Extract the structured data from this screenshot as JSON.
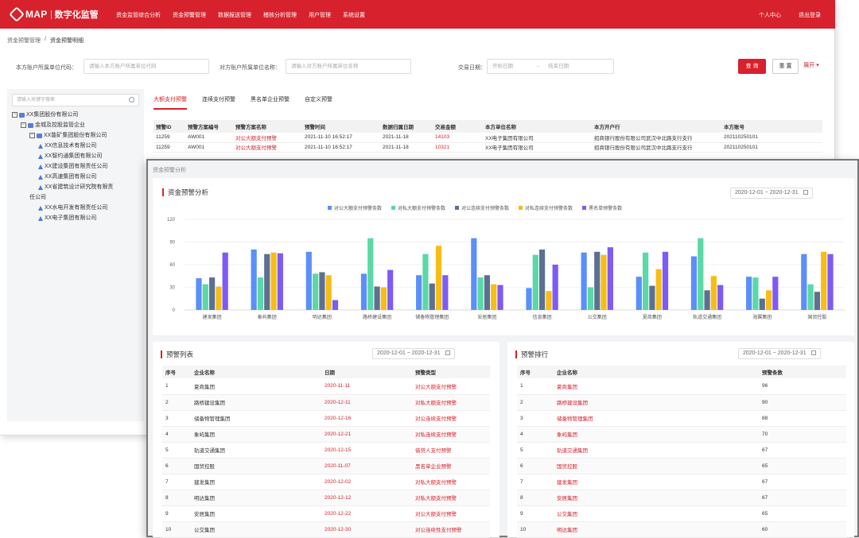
{
  "header": {
    "logo": "MAP",
    "product": "数字化监管",
    "nav": [
      "资金监管综合分析",
      "资金预警管理",
      "数据报送管理",
      "稽核分析管理",
      "用户管理",
      "系统设置"
    ],
    "right": [
      "个人中心",
      "退出登录"
    ]
  },
  "breadcrumb": [
    "资金预警管理",
    "资金预警明细"
  ],
  "filters": {
    "own_label": "本方账户所属单位代码：",
    "own_placeholder": "请输入本方账户所属单位代码",
    "counter_label": "对方账户所属单位名称：",
    "counter_placeholder": "请输入对方账户所属单位名称",
    "date_label": "交易日期：",
    "date_start": "开始日期",
    "date_sep": "→",
    "date_end": "结束日期",
    "query": "查 询",
    "reset": "重 置",
    "expand": "展开 ▾"
  },
  "tree": {
    "search_placeholder": "请输入关键字搜索",
    "nodes": [
      {
        "label": "XX集团股份有限公司",
        "level": 0,
        "kind": "folder",
        "toggle": "−"
      },
      {
        "label": "金城及控股监管企业",
        "level": 1,
        "kind": "folder",
        "toggle": "−"
      },
      {
        "label": "XX能矿集团股份有限公司",
        "level": 2,
        "kind": "folder",
        "toggle": "−"
      },
      {
        "label": "XX信息技术有限公司",
        "level": 3,
        "kind": "home"
      },
      {
        "label": "XX智约通集团有限公司",
        "level": 3,
        "kind": "home"
      },
      {
        "label": "XX建设集团有限责任公司",
        "level": 3,
        "kind": "home"
      },
      {
        "label": "XX高速集团有限公司",
        "level": 3,
        "kind": "home"
      },
      {
        "label": "XX省建筑设计研究院有限责",
        "level": 3,
        "kind": "home"
      },
      {
        "label": "任公司",
        "level": 2,
        "kind": "text"
      },
      {
        "label": "XX水电开发有限责任公司",
        "level": 3,
        "kind": "home"
      },
      {
        "label": "XX电子集团有限公司",
        "level": 3,
        "kind": "home"
      }
    ]
  },
  "tabs": [
    "大额支付预警",
    "连续支付预警",
    "黑名单企业预警",
    "自定义预警"
  ],
  "detail_table": {
    "headers": [
      "预警ID",
      "预警方案编号",
      "预警方案名称",
      "预警时间",
      "数据归属日期",
      "交易金额",
      "本方单位名称",
      "本方开户行",
      "本方账号"
    ],
    "rows": [
      [
        "11259",
        "AW001",
        "对公大额支付预警",
        "2021-11-10 16:52:17",
        "2021-11-18",
        "14103",
        "XX电子集团有限公司",
        "招商银行股份有限公司武汉中北路支行支行",
        "202110250101"
      ],
      [
        "11259",
        "AW001",
        "对公大额支付预警",
        "2021-11-10 16:52:17",
        "2021-11-18",
        "10321",
        "XX电子集团有限公司",
        "招商银行股份有限公司武汉中北路支行支行",
        "202110250101"
      ]
    ]
  },
  "analysis": {
    "window_title": "资金预警分析",
    "chart_title": "资金预警分析",
    "date_range": "2020-12-01  ~  2020-12-31"
  },
  "chart_data": {
    "type": "bar",
    "categories": [
      "建发集团",
      "象屿集团",
      "明达集团",
      "路桥建设集团",
      "储备物管理集团",
      "安居集团",
      "信息集团",
      "公交集团",
      "夏商集团",
      "轨道交通集团",
      "海翼集团",
      "国贸控股"
    ],
    "series": [
      {
        "name": "对公大额支付预警条数",
        "color": "#5b8ff9",
        "values": [
          42,
          80,
          77,
          48,
          46,
          95,
          29,
          76,
          44,
          71,
          44,
          74
        ]
      },
      {
        "name": "对私大额支付预警条数",
        "color": "#5ad8a6",
        "values": [
          34,
          43,
          48,
          95,
          74,
          43,
          73,
          30,
          76,
          95,
          43,
          34
        ]
      },
      {
        "name": "对公连续支付预警条数",
        "color": "#5d7092",
        "values": [
          43,
          74,
          50,
          31,
          35,
          46,
          80,
          77,
          32,
          26,
          15,
          24
        ]
      },
      {
        "name": "对私连续支付预警条数",
        "color": "#f6bd16",
        "values": [
          31,
          76,
          46,
          30,
          85,
          34,
          25,
          73,
          54,
          45,
          26,
          77
        ]
      },
      {
        "name": "黑名单预警条数",
        "color": "#7e5af6",
        "values": [
          76,
          75,
          13,
          53,
          46,
          33,
          60,
          83,
          77,
          33,
          44,
          74
        ]
      }
    ],
    "ylim": [
      0,
      120
    ],
    "yticks": [
      0,
      30,
      60,
      90,
      120
    ]
  },
  "warn_list": {
    "title": "预警列表",
    "date_range": "2020-12-01  ~  2020-12-31",
    "headers": [
      "序号",
      "企业名称",
      "日期",
      "预警类型"
    ],
    "rows": [
      [
        "1",
        "夏商集团",
        "2020-11-11",
        "对公大额支付预警"
      ],
      [
        "2",
        "路桥建设集团",
        "2020-12-11",
        "对私大额支付预警"
      ],
      [
        "3",
        "储备物管理集团",
        "2020-12-16",
        "对公连续支付预警"
      ],
      [
        "4",
        "象屿集团",
        "2020-12-21",
        "对私连续支付预警"
      ],
      [
        "5",
        "轨道交通集团",
        "2020-12-15",
        "借贷人支付预警"
      ],
      [
        "6",
        "国贸控股",
        "2020-11-07",
        "黑名单企业预警"
      ],
      [
        "7",
        "建发集团",
        "2020-12-02",
        "对私大额支付预警"
      ],
      [
        "8",
        "明达集团",
        "2020-12-12",
        "对私大额支付预警"
      ],
      [
        "9",
        "安居集团",
        "2020-12-22",
        "对公大额支付预警"
      ],
      [
        "10",
        "公交集团",
        "2020-12-30",
        "对公连续性支付预警"
      ]
    ]
  },
  "warn_rank": {
    "title": "预警排行",
    "date_range": "2020-12-01  ~  2020-12-31",
    "headers": [
      "序号",
      "企业名称",
      "预警条数"
    ],
    "rows": [
      [
        "1",
        "夏商集团",
        "96"
      ],
      [
        "2",
        "路桥建设集团",
        "90"
      ],
      [
        "3",
        "储备物管理集团",
        "88"
      ],
      [
        "4",
        "象屿集团",
        "70"
      ],
      [
        "5",
        "轨道交通集团",
        "67"
      ],
      [
        "6",
        "国贸控股",
        "65"
      ],
      [
        "7",
        "建发集团",
        "67"
      ],
      [
        "8",
        "安居集团",
        "67"
      ],
      [
        "9",
        "公交集团",
        "65"
      ],
      [
        "10",
        "明达集团",
        "60"
      ]
    ]
  },
  "colors": {
    "brand": "#d7212c",
    "accent_text": "#d7212c"
  }
}
